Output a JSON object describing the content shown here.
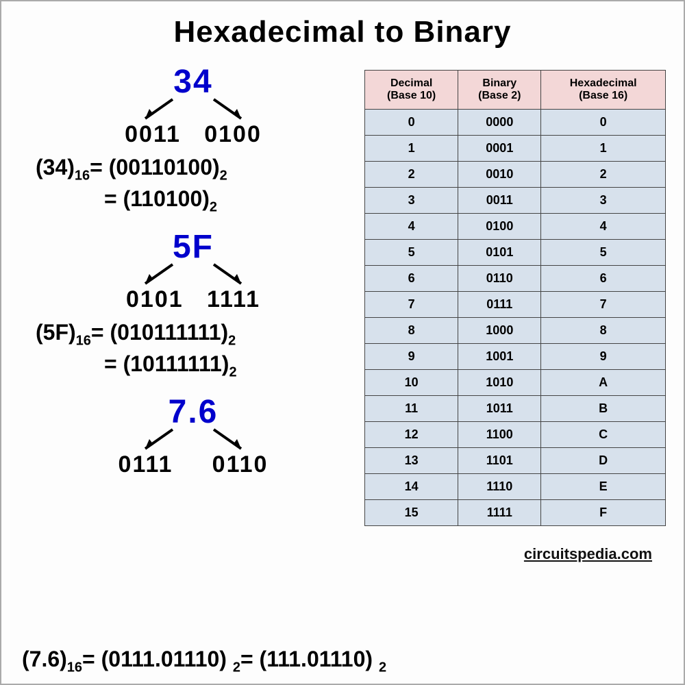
{
  "title": "Hexadecimal to Binary",
  "credit": "circuitspedia.com",
  "ex1": {
    "hex": "34",
    "nibble_a": "0011",
    "nibble_b": "0100",
    "line1_lhs": "(34)",
    "line1_rhs": "(00110100)",
    "line2_rhs": "(110100)"
  },
  "ex2": {
    "hex": "5F",
    "nibble_a": "0101",
    "nibble_b": "1111",
    "line1_lhs": "(5F)",
    "line1_rhs": "(010111111)",
    "line2_rhs": "(10111111)"
  },
  "ex3": {
    "hex": "7.6",
    "nibble_a": "0111",
    "nibble_b": "0110",
    "line_lhs": "(7.6)",
    "line_m": "(0111.01110)",
    "line_r": "(111.01110)"
  },
  "sub16": "16",
  "sub2": "2",
  "eq": "=",
  "table": {
    "headers": [
      "Decimal (Base 10)",
      "Binary (Base 2)",
      "Hexadecimal (Base 16)"
    ],
    "rows": [
      [
        "0",
        "0000",
        "0"
      ],
      [
        "1",
        "0001",
        "1"
      ],
      [
        "2",
        "0010",
        "2"
      ],
      [
        "3",
        "0011",
        "3"
      ],
      [
        "4",
        "0100",
        "4"
      ],
      [
        "5",
        "0101",
        "5"
      ],
      [
        "6",
        "0110",
        "6"
      ],
      [
        "7",
        "0111",
        "7"
      ],
      [
        "8",
        "1000",
        "8"
      ],
      [
        "9",
        "1001",
        "9"
      ],
      [
        "10",
        "1010",
        "A"
      ],
      [
        "11",
        "1011",
        "B"
      ],
      [
        "12",
        "1100",
        "C"
      ],
      [
        "13",
        "1101",
        "D"
      ],
      [
        "14",
        "1110",
        "E"
      ],
      [
        "15",
        "1111",
        "F"
      ]
    ]
  },
  "chart_data": {
    "type": "table",
    "title": "Hexadecimal to Binary conversion table",
    "columns": [
      "Decimal (Base 10)",
      "Binary (Base 2)",
      "Hexadecimal (Base 16)"
    ],
    "rows": [
      [
        0,
        "0000",
        "0"
      ],
      [
        1,
        "0001",
        "1"
      ],
      [
        2,
        "0010",
        "2"
      ],
      [
        3,
        "0011",
        "3"
      ],
      [
        4,
        "0100",
        "4"
      ],
      [
        5,
        "0101",
        "5"
      ],
      [
        6,
        "0110",
        "6"
      ],
      [
        7,
        "0111",
        "7"
      ],
      [
        8,
        "1000",
        "8"
      ],
      [
        9,
        "1001",
        "9"
      ],
      [
        10,
        "1010",
        "A"
      ],
      [
        11,
        "1011",
        "B"
      ],
      [
        12,
        "1100",
        "C"
      ],
      [
        13,
        "1101",
        "D"
      ],
      [
        14,
        "1110",
        "E"
      ],
      [
        15,
        "1111",
        "F"
      ]
    ]
  }
}
